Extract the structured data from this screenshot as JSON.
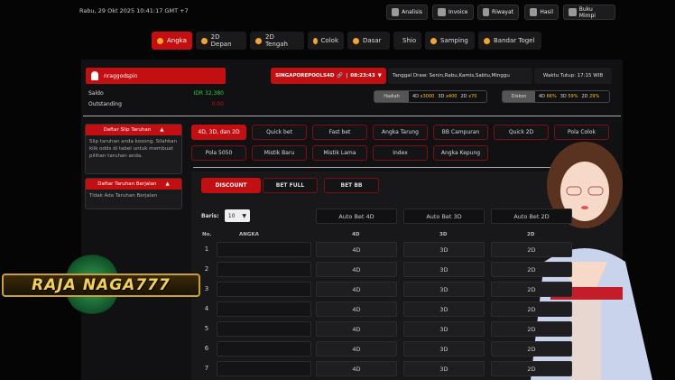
{
  "datetime": "Rabu, 29 Okt 2025 10:41:17 GMT +7",
  "top_buttons": [
    "Analisis",
    "Invoice",
    "Riwayat",
    "Hasil",
    "Buku Mimpi"
  ],
  "nav_tabs": [
    "Angka",
    "2D Depan",
    "2D Tengah",
    "Colok",
    "Dasar",
    "Shio",
    "Samping",
    "Bandar Togel"
  ],
  "user": {
    "name": "nraggodspin",
    "saldo_label": "Saldo",
    "saldo": "IDR 32,380",
    "outstanding_label": "Outstanding",
    "outstanding": "0.00"
  },
  "market": {
    "name": "SINGAPOREPOOLS4D",
    "time": "08:23:43",
    "draw": "Tanggal Draw: Senin,Rabu,Kamis,Sabtu,Minggu",
    "close": "Waktu Tutup: 17:15 WIB"
  },
  "hadiah": {
    "label": "Hadiah",
    "values": [
      {
        "k": "4D",
        "v": "x3000"
      },
      {
        "k": "3D",
        "v": "x400"
      },
      {
        "k": "2D",
        "v": "x70"
      }
    ]
  },
  "diskon": {
    "label": "Diskon",
    "values": [
      {
        "k": "4D",
        "v": "66%"
      },
      {
        "k": "3D",
        "v": "59%"
      },
      {
        "k": "2D",
        "v": "29%"
      }
    ]
  },
  "sidebar": {
    "slip_title": "Daftar Slip Taruhan",
    "slip_text": "Slip taruhan anda kosong. Silahkan klik odds di tabel untuk membuat pilihan taruhan anda.",
    "ongoing_title": "Daftar Taruhan Berjalan",
    "ongoing_text": "Tidak Ada Taruhan Berjalan"
  },
  "game_tabs": [
    "4D, 3D, dan 2D",
    "Quick bet",
    "Fast bet",
    "Angka Tarung",
    "BB Campuran",
    "Quick 2D",
    "Pola Colok",
    "Pola 5050",
    "Mistik Baru",
    "Mistik Lama",
    "Index",
    "Angka Kepung"
  ],
  "bet_modes": [
    "DISCOUNT",
    "BET FULL",
    "BET BB"
  ],
  "to_label": "To",
  "baris_label": "Baris:",
  "baris_value": "10",
  "auto_bets": [
    "Auto Bet 4D",
    "Auto Bet 3D",
    "Auto Bet 2D"
  ],
  "table": {
    "headers": [
      "No.",
      "ANGKA",
      "4D",
      "3D",
      "2D"
    ],
    "rows": [
      "1",
      "2",
      "3",
      "4",
      "5",
      "6",
      "7"
    ],
    "cells": [
      "4D",
      "3D",
      "2D"
    ]
  },
  "logo_text": "RAJA NAGA777",
  "colors": {
    "accent": "#c40f12",
    "green": "#2ecc40",
    "gold": "#f2c12e"
  }
}
